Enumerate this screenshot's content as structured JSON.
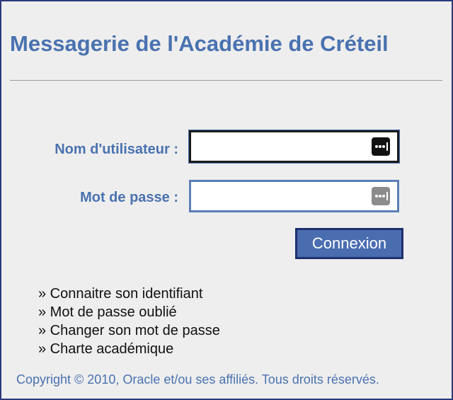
{
  "header": {
    "title": "Messagerie de l'Académie de Créteil"
  },
  "form": {
    "username_label": "Nom d'utilisateur :",
    "username_value": "",
    "password_label": "Mot de passe :",
    "password_value": "",
    "submit_label": "Connexion"
  },
  "links": [
    {
      "label": "» Connaitre son identifiant"
    },
    {
      "label": "» Mot de passe oublié"
    },
    {
      "label": "» Changer son mot de passe"
    },
    {
      "label": "» Charte académique"
    }
  ],
  "footer": {
    "copyright": "Copyright © 2010, Oracle et/ou ses affiliés. Tous droits réservés."
  },
  "icons": {
    "username_field": "password-manager-key-icon",
    "password_field": "password-manager-key-icon"
  },
  "colors": {
    "accent": "#4a72b0",
    "button": "#4a6db0",
    "button_border": "#1f2f6e",
    "frame_border": "#2b3a7a",
    "background": "#eeeeee"
  }
}
